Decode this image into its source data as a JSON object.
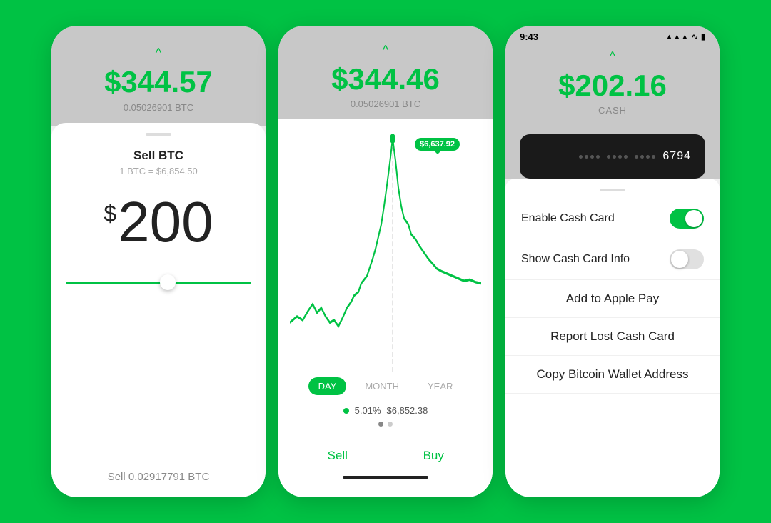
{
  "phone1": {
    "header": {
      "chevron": "^",
      "amount": "$344.57",
      "btc_label": "0.05026901 BTC"
    },
    "body": {
      "sell_title": "Sell BTC",
      "rate": "1 BTC = $6,854.50",
      "dollar_sign": "$",
      "dollar_value": "200",
      "sell_label": "Sell 0.02917791 BTC"
    }
  },
  "phone2": {
    "header": {
      "chevron": "^",
      "amount": "$344.46",
      "btc_label": "0.05026901 BTC"
    },
    "chart": {
      "tooltip": "$6,637.92"
    },
    "tabs": [
      {
        "label": "DAY",
        "active": true
      },
      {
        "label": "MONTH",
        "active": false
      },
      {
        "label": "YEAR",
        "active": false
      }
    ],
    "price_change": "5.01%",
    "price_value": "$6,852.38",
    "sell_btn": "Sell",
    "buy_btn": "Buy"
  },
  "phone3": {
    "status_bar": {
      "time": "9:43",
      "signal": "●●● ▼",
      "wifi": "wifi",
      "battery": "battery"
    },
    "header": {
      "chevron": "^",
      "amount": "$202.16",
      "cash_label": "CASH"
    },
    "card": {
      "dots_groups": 3,
      "last4": "6794"
    },
    "action_sheet": {
      "enable_cash_card_label": "Enable Cash Card",
      "enable_cash_card_on": true,
      "show_cash_card_info_label": "Show Cash Card Info",
      "show_cash_card_info_on": false,
      "add_apple_pay_label": "Add to Apple Pay",
      "report_lost_label": "Report Lost Cash Card",
      "copy_bitcoin_label": "Copy Bitcoin Wallet Address"
    }
  }
}
